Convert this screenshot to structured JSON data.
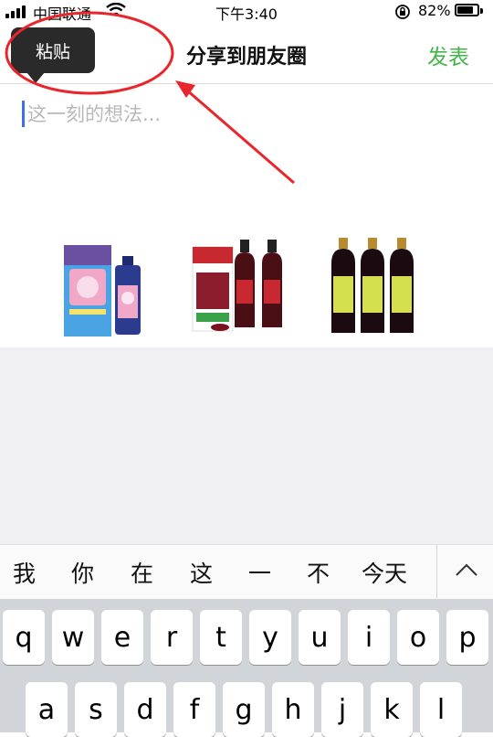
{
  "status_bar": {
    "carrier": "中国联通",
    "time": "下午3:40",
    "battery_percent": "82%",
    "battery_level": 0.82,
    "icons": [
      "signal-icon",
      "wifi-icon",
      "orientation-lock-icon",
      "battery-icon"
    ]
  },
  "nav": {
    "title": "分享到朋友圈",
    "post_label": "发表",
    "post_color": "#44b549"
  },
  "context_menu": {
    "paste_label": "粘贴"
  },
  "composer": {
    "placeholder": "这一刻的想法...",
    "value": "",
    "caret_color": "#3e6fe8"
  },
  "images": [
    {
      "name": "product-image-baby-dha",
      "icon": "product-photo"
    },
    {
      "name": "product-image-floradix",
      "icon": "product-photo"
    },
    {
      "name": "product-image-tonic-bottles",
      "icon": "product-photo"
    }
  ],
  "annotation": {
    "color": "#e8262b",
    "shapes": [
      "ellipse",
      "arrow"
    ]
  },
  "candidates": [
    "我",
    "你",
    "在",
    "这",
    "一",
    "不",
    "今天"
  ],
  "candidate_expand_icon": "chevron-up-icon",
  "keyboard": {
    "row1": [
      "q",
      "w",
      "e",
      "r",
      "t",
      "y",
      "u",
      "i",
      "o",
      "p"
    ],
    "row2": [
      "a",
      "s",
      "d",
      "f",
      "g",
      "h",
      "j",
      "k",
      "l"
    ]
  }
}
